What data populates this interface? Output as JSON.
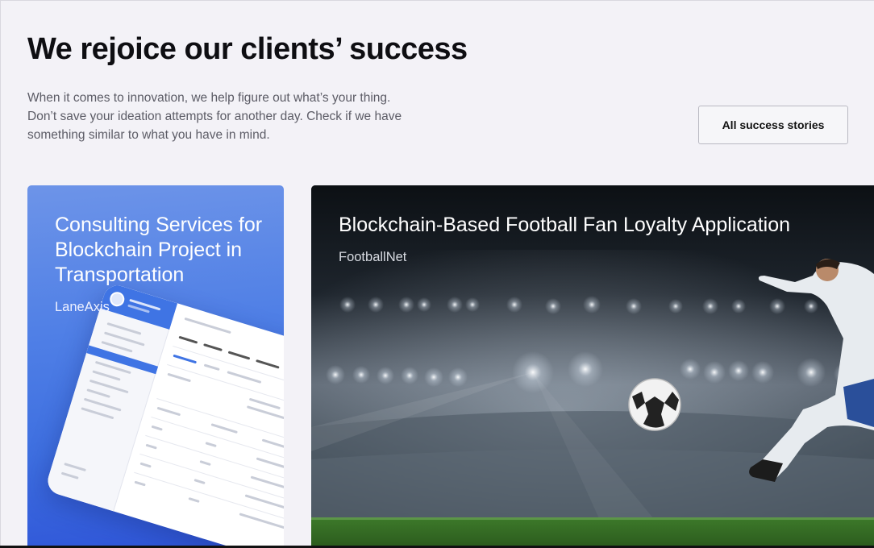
{
  "header": {
    "title": "We rejoice our clients’ success",
    "intro_lines": [
      "When it comes to innovation, we help figure out what’s your thing.",
      "Don’t save your ideation attempts for another day. Check if we have",
      "something similar to what you have in mind."
    ],
    "all_stories_label": "All success stories"
  },
  "cards": [
    {
      "title": "Consulting Services for Blockchain Project in Transportation",
      "client": "LaneAxis",
      "image": "tablet-dashboard-mockup",
      "accent": "#4f7fe6"
    },
    {
      "title": "Blockchain-Based Football Fan Loyalty Application",
      "client": "FootballNet",
      "image": "football-player-kicking-ball-in-stadium"
    }
  ]
}
